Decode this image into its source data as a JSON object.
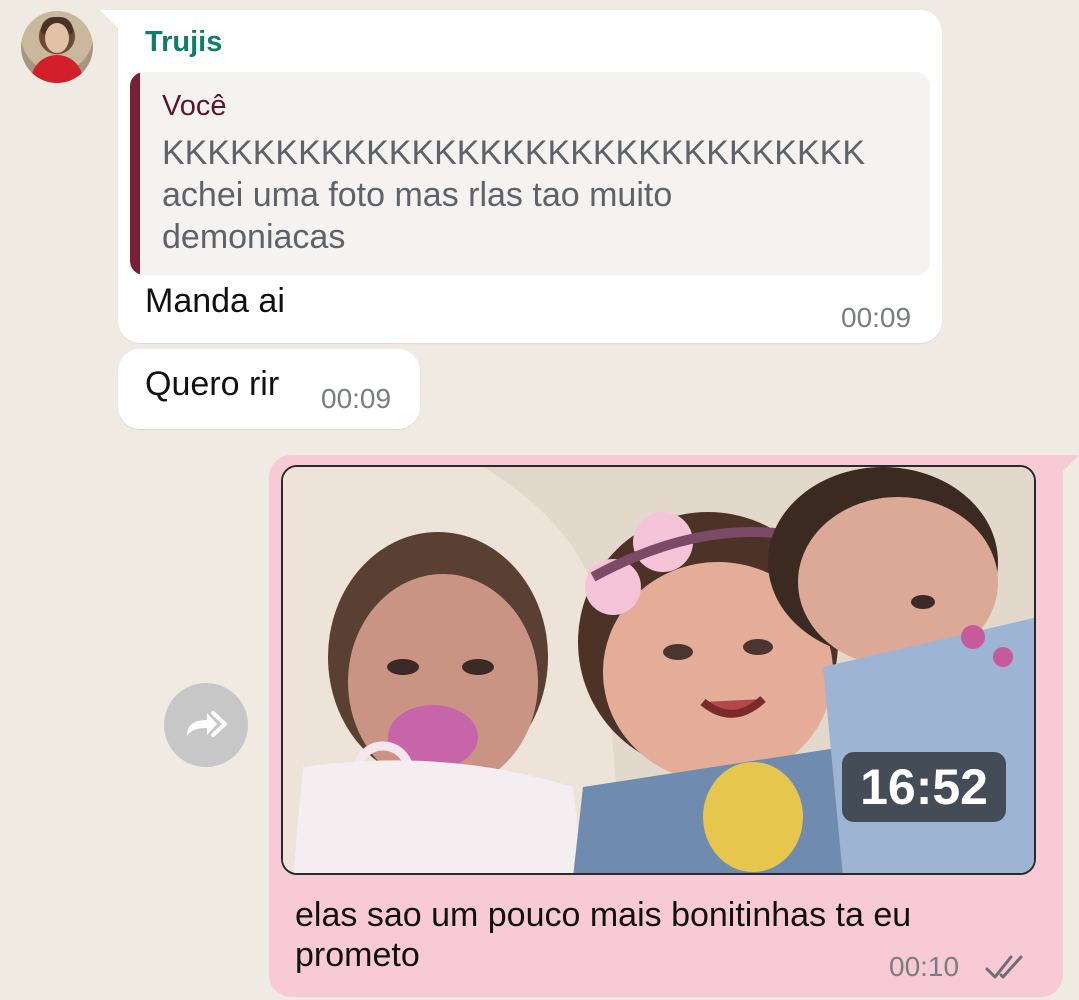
{
  "contact": {
    "name": "Trujis"
  },
  "messages": {
    "incoming_1": {
      "quote_author": "Você",
      "quote_lines": [
        "KKKKKKKKKKKKKKKKKKKKKKKKKKKKKKK",
        "achei uma foto mas rlas tao muito",
        "demoniacas"
      ],
      "text": "Manda ai",
      "time": "00:09"
    },
    "incoming_2": {
      "text": "Quero rir",
      "time": "00:09"
    },
    "outgoing_1": {
      "video_duration": "16:52",
      "caption_lines": [
        "elas sao um pouco mais bonitinhas ta eu",
        "prometo"
      ],
      "time": "00:10",
      "status_icon": "double-check-icon"
    }
  },
  "colors": {
    "background": "#efeae2",
    "incoming_bubble": "#ffffff",
    "outgoing_bubble": "#f8cad6",
    "sender_name": "#0f7c6e",
    "quote_bar": "#7a1f3a"
  }
}
